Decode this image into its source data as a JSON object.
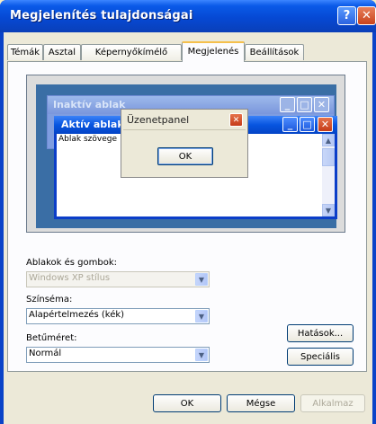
{
  "window": {
    "title": "Megjelenítés tulajdonságai"
  },
  "titlebar_buttons": {
    "help": "?",
    "close": "✕"
  },
  "tabs": [
    {
      "label": "Témák"
    },
    {
      "label": "Asztal"
    },
    {
      "label": "Képernyőkímélő"
    },
    {
      "label": "Megjelenés",
      "active": true
    },
    {
      "label": "Beállítások"
    }
  ],
  "preview": {
    "inactive_title": "Inaktív ablak",
    "active_title": "Aktív ablak",
    "window_text": "Ablak szövege",
    "message_title": "Üzenetpanel",
    "message_ok": "OK"
  },
  "fields": {
    "windows_label": "Ablakok és gombok:",
    "windows_value": "Windows XP stílus",
    "color_label": "Színséma:",
    "color_value": "Alapértelmezés (kék)",
    "font_label": "Betűméret:",
    "font_value": "Normál"
  },
  "buttons": {
    "effects": "Hatások...",
    "advanced": "Speciális",
    "ok": "OK",
    "cancel": "Mégse",
    "apply": "Alkalmaz"
  },
  "colors": {
    "xp_blue": "#0a43c8",
    "dialog_bg": "#ece9d8",
    "desktop": "#3a6ea5"
  }
}
